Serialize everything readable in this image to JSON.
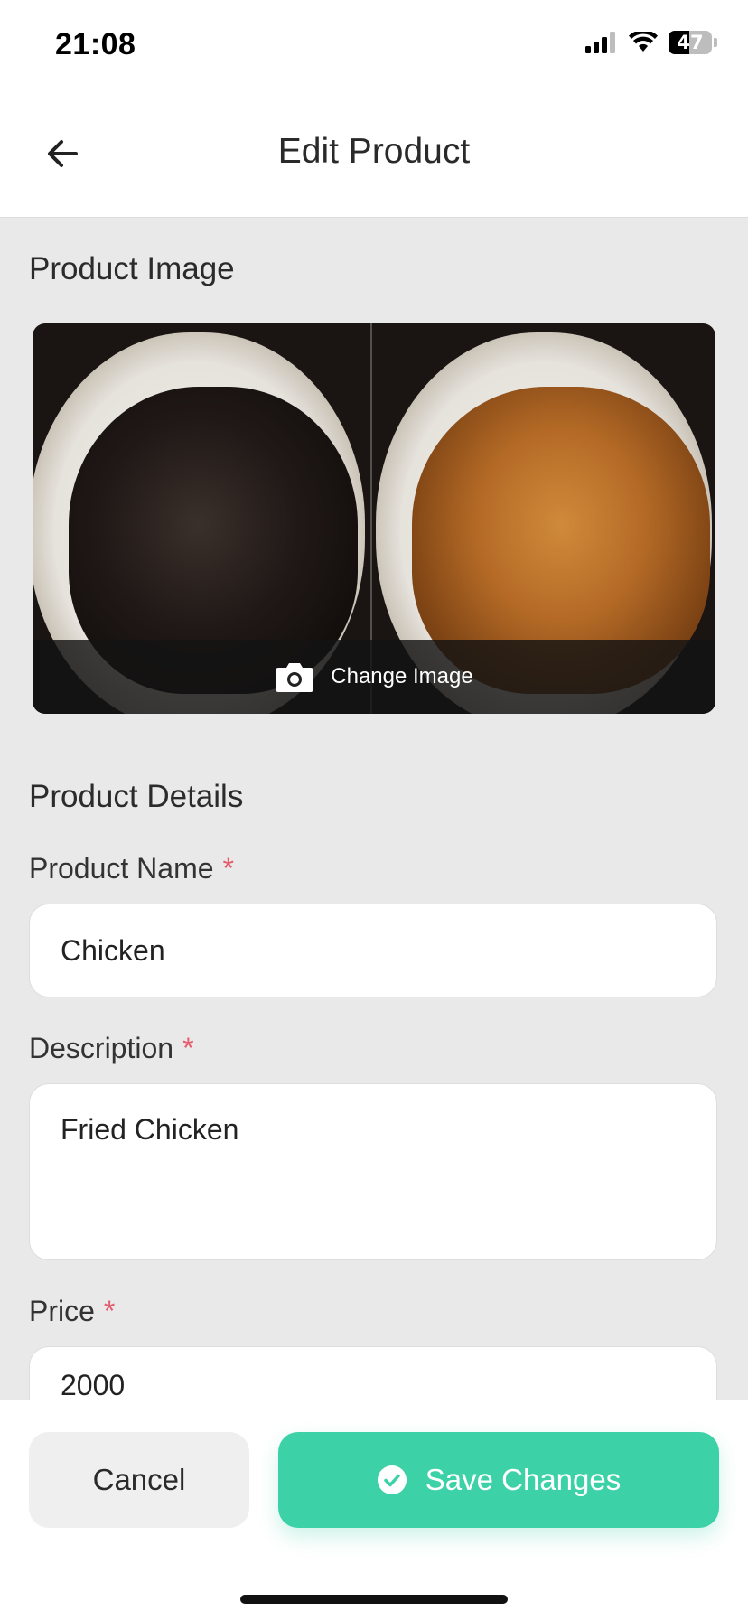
{
  "status_bar": {
    "time": "21:08",
    "battery_level": "47"
  },
  "header": {
    "title": "Edit Product"
  },
  "image_section": {
    "label": "Product Image",
    "change_label": "Change Image"
  },
  "details": {
    "label": "Product Details",
    "fields": {
      "name": {
        "label": "Product Name",
        "required_mark": "*",
        "value": "Chicken"
      },
      "description": {
        "label": "Description",
        "required_mark": "*",
        "value": "Fried Chicken"
      },
      "price": {
        "label": "Price",
        "required_mark": "*",
        "value": "2000"
      }
    }
  },
  "actions": {
    "cancel_label": "Cancel",
    "save_label": "Save Changes"
  },
  "colors": {
    "accent": "#3dd1a8",
    "required": "#e45b6b",
    "background": "#e9e9e9"
  },
  "icons": [
    "back-arrow-icon",
    "camera-icon",
    "check-circle-icon",
    "signal-icon",
    "wifi-icon",
    "battery-icon"
  ]
}
